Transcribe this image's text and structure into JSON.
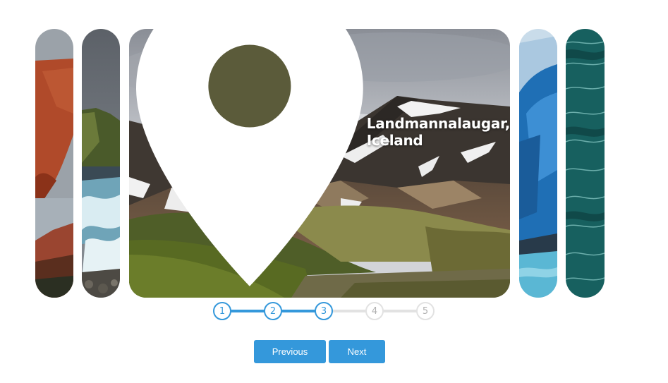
{
  "gallery": {
    "slides": [
      {
        "scene": "red-rock-arch"
      },
      {
        "scene": "waterfall-cliff"
      },
      {
        "scene": "landmannalaugar-mountains",
        "caption": "Landmannalaugar, Iceland",
        "icon": "location-pin-icon"
      },
      {
        "scene": "blue-glacier-ice"
      },
      {
        "scene": "teal-ocean-waves"
      }
    ],
    "active_index": 3
  },
  "stepper": {
    "steps": [
      "1",
      "2",
      "3",
      "4",
      "5"
    ],
    "current": 3
  },
  "controls": {
    "previous_label": "Previous",
    "next_label": "Next"
  },
  "colors": {
    "accent": "#3498db",
    "inactive": "#e2e2e2",
    "inactive_text": "#b0b0b0"
  }
}
